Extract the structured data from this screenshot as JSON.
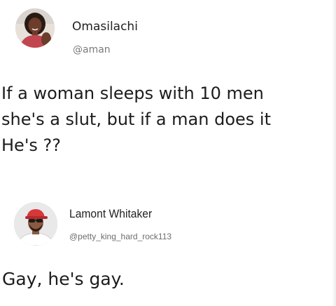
{
  "posts": [
    {
      "author": {
        "name": "Omasilachi",
        "handle": "@aman"
      },
      "lines": [
        "If a woman sleeps with 10 men",
        "she's a slut, but if a man does it",
        "He's ??"
      ]
    },
    {
      "author": {
        "name": "Lamont Whitaker",
        "handle": "@petty_king_hard_rock113"
      },
      "lines": [
        "Gay, he's gay."
      ]
    }
  ],
  "colors": {
    "text": "#1c1c1c",
    "handle": "#7a7a7a",
    "avatar1_shirt": "#c2464f",
    "avatar2_cap": "#d6383a"
  }
}
